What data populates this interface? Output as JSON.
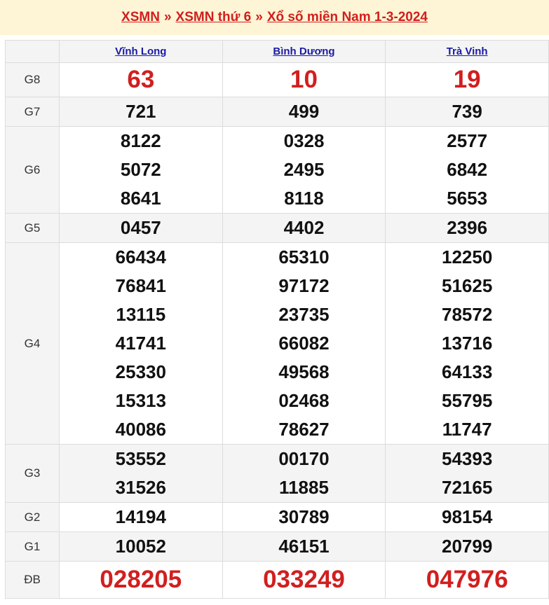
{
  "breadcrumb": {
    "link1": "XSMN",
    "link2": "XSMN thứ 6",
    "link3": "Xổ số miền Nam 1-3-2024",
    "separator": "»"
  },
  "provinces": [
    "Vĩnh Long",
    "Bình Dương",
    "Trà Vinh"
  ],
  "prizes": [
    {
      "label": "G8",
      "values": [
        [
          "63"
        ],
        [
          "10"
        ],
        [
          "19"
        ]
      ]
    },
    {
      "label": "G7",
      "values": [
        [
          "721"
        ],
        [
          "499"
        ],
        [
          "739"
        ]
      ]
    },
    {
      "label": "G6",
      "values": [
        [
          "8122",
          "5072",
          "8641"
        ],
        [
          "0328",
          "2495",
          "8118"
        ],
        [
          "2577",
          "6842",
          "5653"
        ]
      ]
    },
    {
      "label": "G5",
      "values": [
        [
          "0457"
        ],
        [
          "4402"
        ],
        [
          "2396"
        ]
      ]
    },
    {
      "label": "G4",
      "values": [
        [
          "66434",
          "76841",
          "13115",
          "41741",
          "25330",
          "15313",
          "40086"
        ],
        [
          "65310",
          "97172",
          "23735",
          "66082",
          "49568",
          "02468",
          "78627"
        ],
        [
          "12250",
          "51625",
          "78572",
          "13716",
          "64133",
          "55795",
          "11747"
        ]
      ]
    },
    {
      "label": "G3",
      "values": [
        [
          "53552",
          "31526"
        ],
        [
          "00170",
          "11885"
        ],
        [
          "54393",
          "72165"
        ]
      ]
    },
    {
      "label": "G2",
      "values": [
        [
          "14194"
        ],
        [
          "30789"
        ],
        [
          "98154"
        ]
      ]
    },
    {
      "label": "G1",
      "values": [
        [
          "10052"
        ],
        [
          "46151"
        ],
        [
          "20799"
        ]
      ]
    },
    {
      "label": "ĐB",
      "values": [
        [
          "028205"
        ],
        [
          "033249"
        ],
        [
          "047976"
        ]
      ]
    }
  ],
  "colors": {
    "accent_red": "#d11f1f",
    "link_blue": "#1a1aa6",
    "header_bg": "#fdf5d5"
  }
}
